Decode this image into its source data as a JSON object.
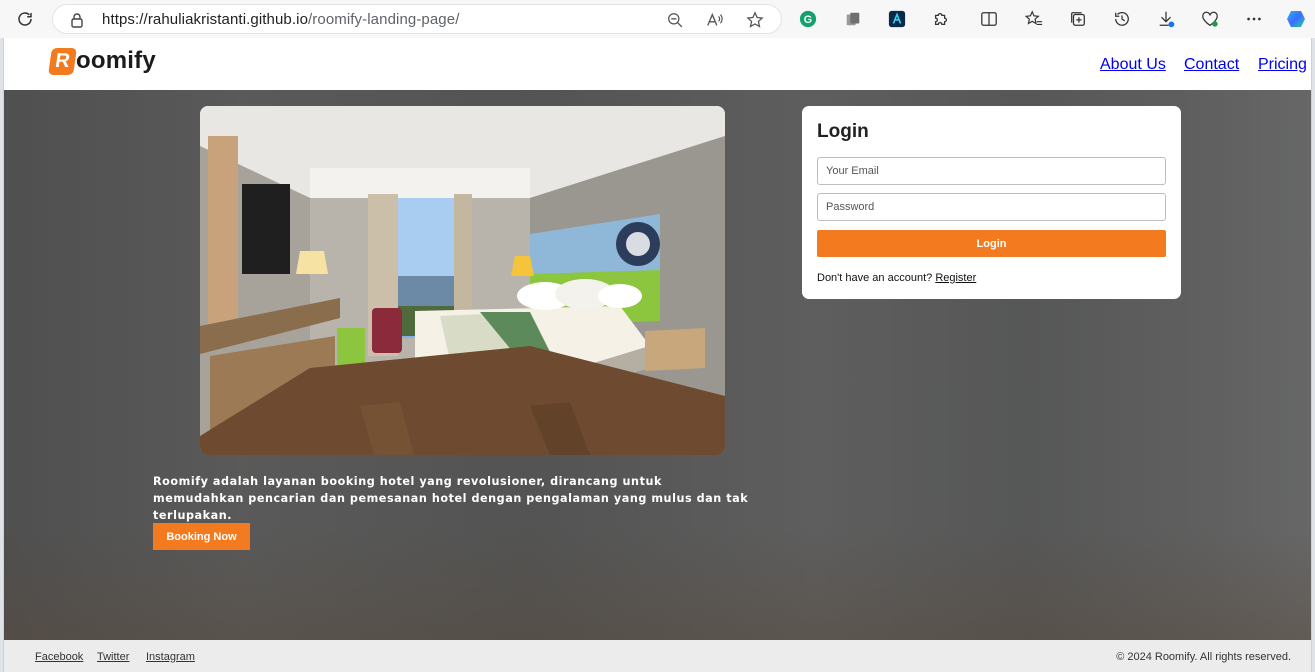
{
  "browser": {
    "url_host": "https://rahuliakristanti.github.io",
    "url_path": "/roomify-landing-page/",
    "icons": [
      "reload-icon",
      "lock-icon",
      "zoom-out-icon",
      "read-aloud-icon",
      "favorite-star-icon",
      "grammarly-extension-icon",
      "extension-icon",
      "ai-extension-icon",
      "extensions-puzzle-icon",
      "split-screen-icon",
      "favorites-icon",
      "collections-icon",
      "history-icon",
      "downloads-icon",
      "browser-essentials-icon",
      "more-menu-icon",
      "copilot-icon"
    ]
  },
  "site": {
    "logo_letter": "R",
    "logo_rest": "oomify",
    "nav": {
      "about": "About Us",
      "contact": "Contact",
      "pricing": "Pricing"
    }
  },
  "hero": {
    "description": "Roomify adalah layanan booking hotel yang revolusioner, dirancang untuk memudahkan pencarian dan pemesanan hotel dengan pengalaman yang mulus dan tak terlupakan.",
    "booking_label": "Booking Now"
  },
  "login": {
    "title": "Login",
    "email_placeholder": "Your Email",
    "password_placeholder": "Password",
    "button_label": "Login",
    "register_prompt": "Don't have an account?",
    "register_link": "Register"
  },
  "footer": {
    "links": [
      "Facebook",
      "Twitter",
      "Instagram"
    ],
    "copyright": "© 2024 Roomify. All rights reserved."
  },
  "colors": {
    "accent": "#f47a1f",
    "overlay": "#4b4b4b"
  }
}
